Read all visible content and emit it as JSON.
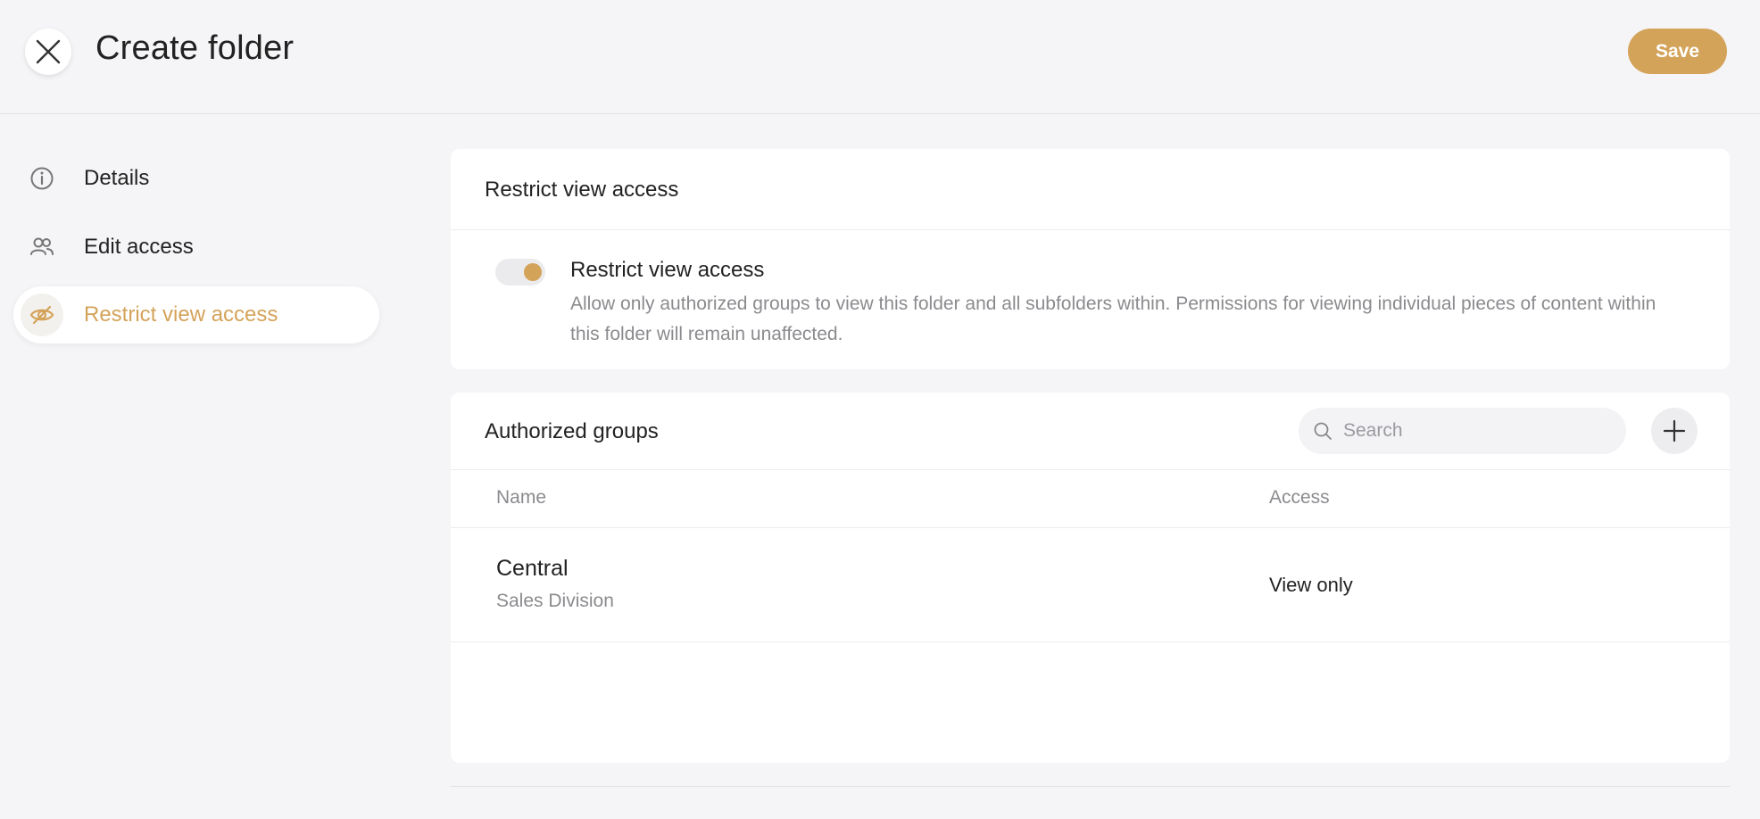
{
  "header": {
    "title": "Create folder",
    "save_label": "Save",
    "close_icon": "close-icon"
  },
  "sidebar": {
    "items": [
      {
        "label": "Details",
        "icon": "info-icon",
        "active": false
      },
      {
        "label": "Edit access",
        "icon": "users-icon",
        "active": false
      },
      {
        "label": "Restrict view access",
        "icon": "eye-slash-icon",
        "active": true
      }
    ]
  },
  "restrict_card": {
    "title": "Restrict view access",
    "toggle_on": true,
    "option_title": "Restrict view access",
    "option_description": "Allow only authorized groups to view this folder and all subfolders within. Permissions for viewing individual pieces of content within this folder will remain unaffected."
  },
  "groups_card": {
    "title": "Authorized groups",
    "search_placeholder": "Search",
    "columns": [
      "Name",
      "Access"
    ],
    "rows": [
      {
        "name": "Central",
        "subtitle": "Sales Division",
        "access": "View only"
      }
    ]
  },
  "colors": {
    "accent": "#d4a35a",
    "background": "#f5f5f7",
    "card": "#ffffff",
    "muted_text": "#8b8b8f"
  }
}
